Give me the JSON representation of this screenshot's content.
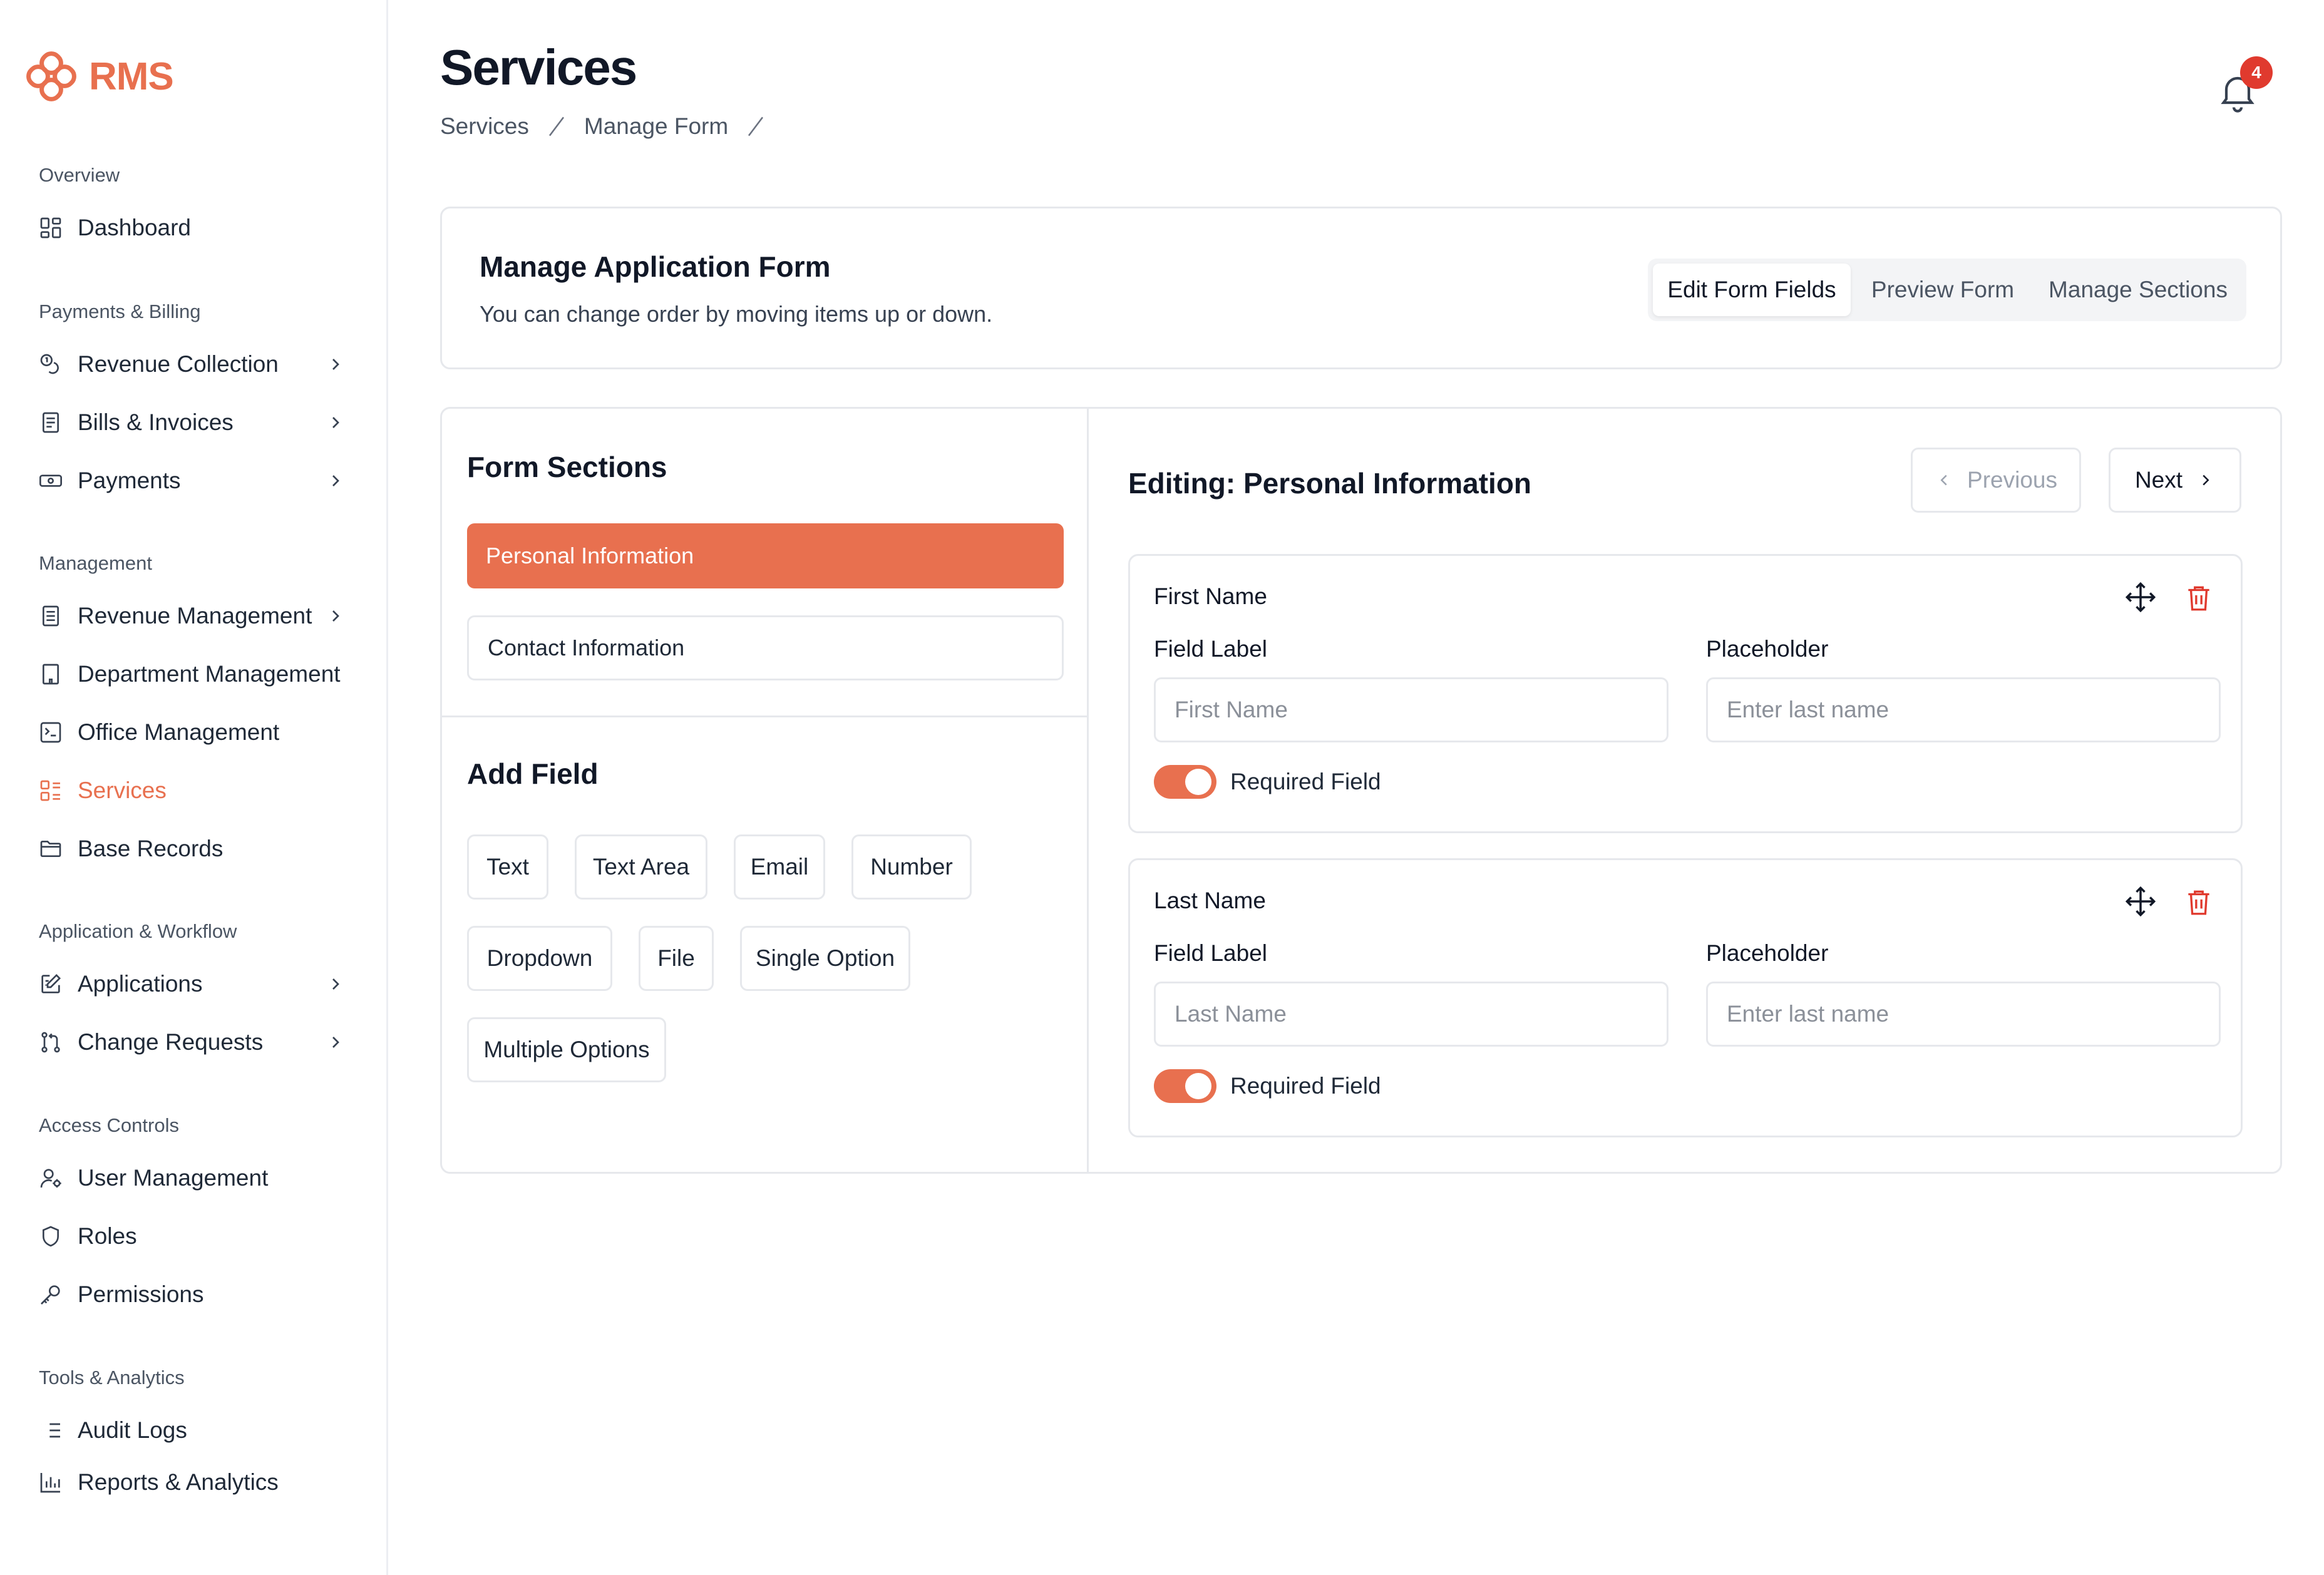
{
  "app": {
    "name": "RMS",
    "brand_color": "#e8704f"
  },
  "sidebar": {
    "sections": [
      {
        "heading": "Overview",
        "items": [
          {
            "label": "Dashboard",
            "icon": "dashboard-grid-icon",
            "has_chevron": false
          }
        ]
      },
      {
        "heading": "Payments & Billing",
        "items": [
          {
            "label": "Revenue Collection",
            "icon": "coins-icon",
            "has_chevron": true
          },
          {
            "label": "Bills & Invoices",
            "icon": "receipt-icon",
            "has_chevron": true
          },
          {
            "label": "Payments",
            "icon": "banknote-icon",
            "has_chevron": true
          }
        ]
      },
      {
        "heading": "Management",
        "items": [
          {
            "label": "Revenue Management",
            "icon": "document-icon",
            "has_chevron": true
          },
          {
            "label": "Department Management",
            "icon": "building-icon",
            "has_chevron": false
          },
          {
            "label": "Office Management",
            "icon": "office-icon",
            "has_chevron": false
          },
          {
            "label": "Services",
            "icon": "services-list-icon",
            "has_chevron": false,
            "active": true
          },
          {
            "label": "Base Records",
            "icon": "folder-icon",
            "has_chevron": false
          }
        ]
      },
      {
        "heading": "Application & Workflow",
        "items": [
          {
            "label": "Applications",
            "icon": "edit-form-icon",
            "has_chevron": true
          },
          {
            "label": "Change Requests",
            "icon": "git-pull-request-icon",
            "has_chevron": true
          }
        ]
      },
      {
        "heading": "Access Controls",
        "items": [
          {
            "label": "User Management",
            "icon": "user-cog-icon",
            "has_chevron": false
          },
          {
            "label": "Roles",
            "icon": "shield-icon",
            "has_chevron": false
          },
          {
            "label": "Permissions",
            "icon": "key-icon",
            "has_chevron": false
          }
        ]
      },
      {
        "heading": "Tools & Analytics",
        "items": [
          {
            "label": "Audit Logs",
            "icon": "list-icon",
            "has_chevron": false
          },
          {
            "label": "Reports & Analytics",
            "icon": "bar-chart-icon",
            "has_chevron": false
          }
        ]
      }
    ]
  },
  "header": {
    "title": "Services",
    "breadcrumb": [
      "Services",
      "Manage Form"
    ],
    "notification_count": "4"
  },
  "manage_form": {
    "title": "Manage Application Form",
    "subtitle": "You can change order by moving items up or down.",
    "tabs": [
      {
        "label": "Edit Form Fields",
        "active": true
      },
      {
        "label": "Preview Form",
        "active": false
      },
      {
        "label": "Manage Sections",
        "active": false
      }
    ]
  },
  "form_sections": {
    "title": "Form Sections",
    "items": [
      {
        "label": "Personal Information",
        "active": true
      },
      {
        "label": "Contact Information",
        "active": false
      }
    ]
  },
  "add_field": {
    "title": "Add Field",
    "types": [
      "Text",
      "Text Area",
      "Email",
      "Number",
      "Dropdown",
      "File",
      "Single Option",
      "Multiple Options"
    ]
  },
  "editor": {
    "title": "Editing: Personal Information",
    "previous_label": "Previous",
    "next_label": "Next",
    "fields": [
      {
        "name": "First Name",
        "field_label_caption": "Field Label",
        "field_label_value": "",
        "field_label_placeholder": "First Name",
        "placeholder_caption": "Placeholder",
        "placeholder_value": "",
        "placeholder_placeholder": "Enter last name",
        "required_label": "Required Field",
        "required": true
      },
      {
        "name": "Last Name",
        "field_label_caption": "Field Label",
        "field_label_value": "",
        "field_label_placeholder": "Last Name",
        "placeholder_caption": "Placeholder",
        "placeholder_value": "",
        "placeholder_placeholder": "Enter last name",
        "required_label": "Required Field",
        "required": true
      }
    ]
  }
}
